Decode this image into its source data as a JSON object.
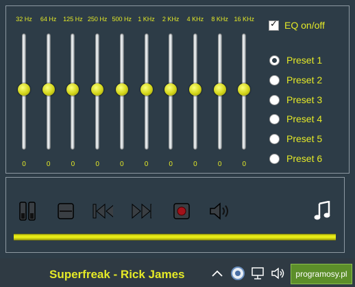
{
  "equalizer": {
    "bands": [
      {
        "label": "32 Hz",
        "value": "0"
      },
      {
        "label": "64 Hz",
        "value": "0"
      },
      {
        "label": "125 Hz",
        "value": "0"
      },
      {
        "label": "250 Hz",
        "value": "0"
      },
      {
        "label": "500 Hz",
        "value": "0"
      },
      {
        "label": "1 KHz",
        "value": "0"
      },
      {
        "label": "2 KHz",
        "value": "0"
      },
      {
        "label": "4 KHz",
        "value": "0"
      },
      {
        "label": "8 KHz",
        "value": "0"
      },
      {
        "label": "16 KHz",
        "value": "0"
      }
    ],
    "toggle_label": "EQ on/off",
    "toggle_checked": true
  },
  "presets": [
    {
      "label": "Preset 1",
      "selected": true
    },
    {
      "label": "Preset 2",
      "selected": false
    },
    {
      "label": "Preset 3",
      "selected": false
    },
    {
      "label": "Preset 4",
      "selected": false
    },
    {
      "label": "Preset 5",
      "selected": false
    },
    {
      "label": "Preset 6",
      "selected": false
    }
  ],
  "player": {
    "controls": [
      "pause-icon",
      "stop-icon",
      "previous-icon",
      "next-icon",
      "record-icon",
      "volume-icon",
      "music-note-icon"
    ],
    "progress": 1.0
  },
  "taskbar": {
    "now_playing": "Superfreak - Rick James",
    "badge_text": "programosy.pl"
  },
  "colors": {
    "accent": "#e5ea27",
    "background": "#2d3c47"
  }
}
